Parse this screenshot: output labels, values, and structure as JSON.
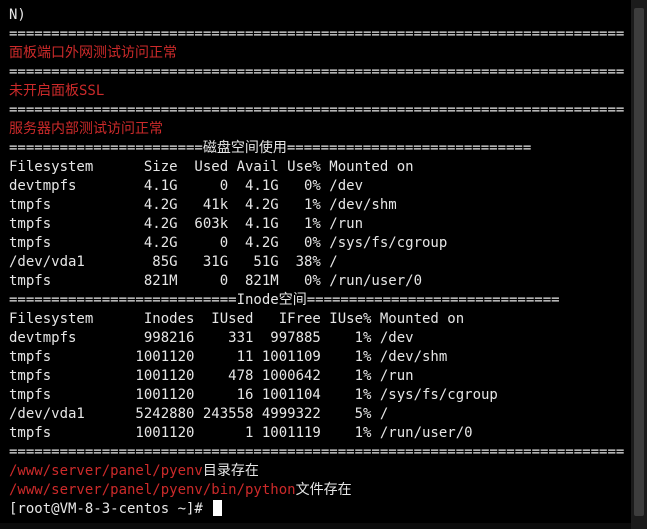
{
  "terminal": {
    "top_line": "N)",
    "sep_full": "=========================================================================",
    "port_ext_msg": "面板端口外网测试访问正常",
    "ssl_msg": "未开启面板SSL",
    "internal_msg": "服务器内部测试访问正常",
    "disk_sep": "=======================磁盘空间使用=============================",
    "df_header": "Filesystem      Size  Used Avail Use% Mounted on",
    "df_rows": [
      "devtmpfs        4.1G     0  4.1G   0% /dev",
      "tmpfs           4.2G   41k  4.2G   1% /dev/shm",
      "tmpfs           4.2G  603k  4.1G   1% /run",
      "tmpfs           4.2G     0  4.2G   0% /sys/fs/cgroup",
      "/dev/vda1        85G   31G   51G  38% /",
      "tmpfs           821M     0  821M   0% /run/user/0"
    ],
    "inode_sep": "===========================Inode空间==============================",
    "inode_header": "Filesystem      Inodes  IUsed   IFree IUse% Mounted on",
    "inode_rows": [
      "devtmpfs        998216    331  997885    1% /dev",
      "tmpfs          1001120     11 1001109    1% /dev/shm",
      "tmpfs          1001120    478 1000642    1% /run",
      "tmpfs          1001120     16 1001104    1% /sys/fs/cgroup",
      "/dev/vda1      5242880 243558 4999322    5% /",
      "tmpfs          1001120      1 1001119    1% /run/user/0"
    ],
    "pyenv_path": "/www/server/panel/pyenv",
    "pyenv_msg": "目录存在",
    "python_path": "/www/server/panel/pyenv/bin/python",
    "python_msg": "文件存在",
    "prompt": "[root@VM-8-3-centos ~]# "
  },
  "colors": {
    "background": "#000000",
    "text": "#e6e6e6",
    "alert_red": "#cc2a2a",
    "scrollbar_thumb": "#3d3d3d"
  }
}
